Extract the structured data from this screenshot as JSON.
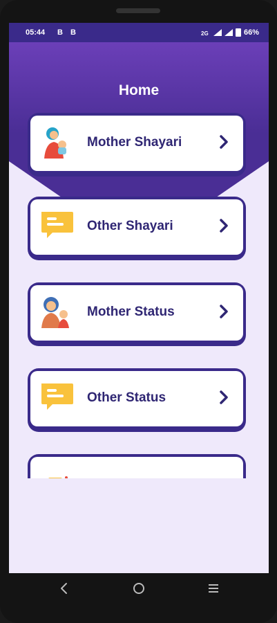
{
  "status_bar": {
    "time": "05:44",
    "left_icons": "B B",
    "battery": "66%"
  },
  "header": {
    "title": "Home"
  },
  "colors": {
    "primary": "#3a2a8a",
    "header_top": "#6b3fb8",
    "background": "#efe9fb",
    "icon_yellow": "#f9c23c"
  },
  "menu": [
    {
      "label": "Mother Shayari",
      "icon": "mother-child-icon"
    },
    {
      "label": "Other Shayari",
      "icon": "chat-bubble-icon"
    },
    {
      "label": "Mother Status",
      "icon": "mother-son-icon"
    },
    {
      "label": "Other Status",
      "icon": "chat-bubble-icon"
    }
  ],
  "nav": {
    "back": "back-icon",
    "home": "home-icon",
    "recents": "recents-icon"
  }
}
